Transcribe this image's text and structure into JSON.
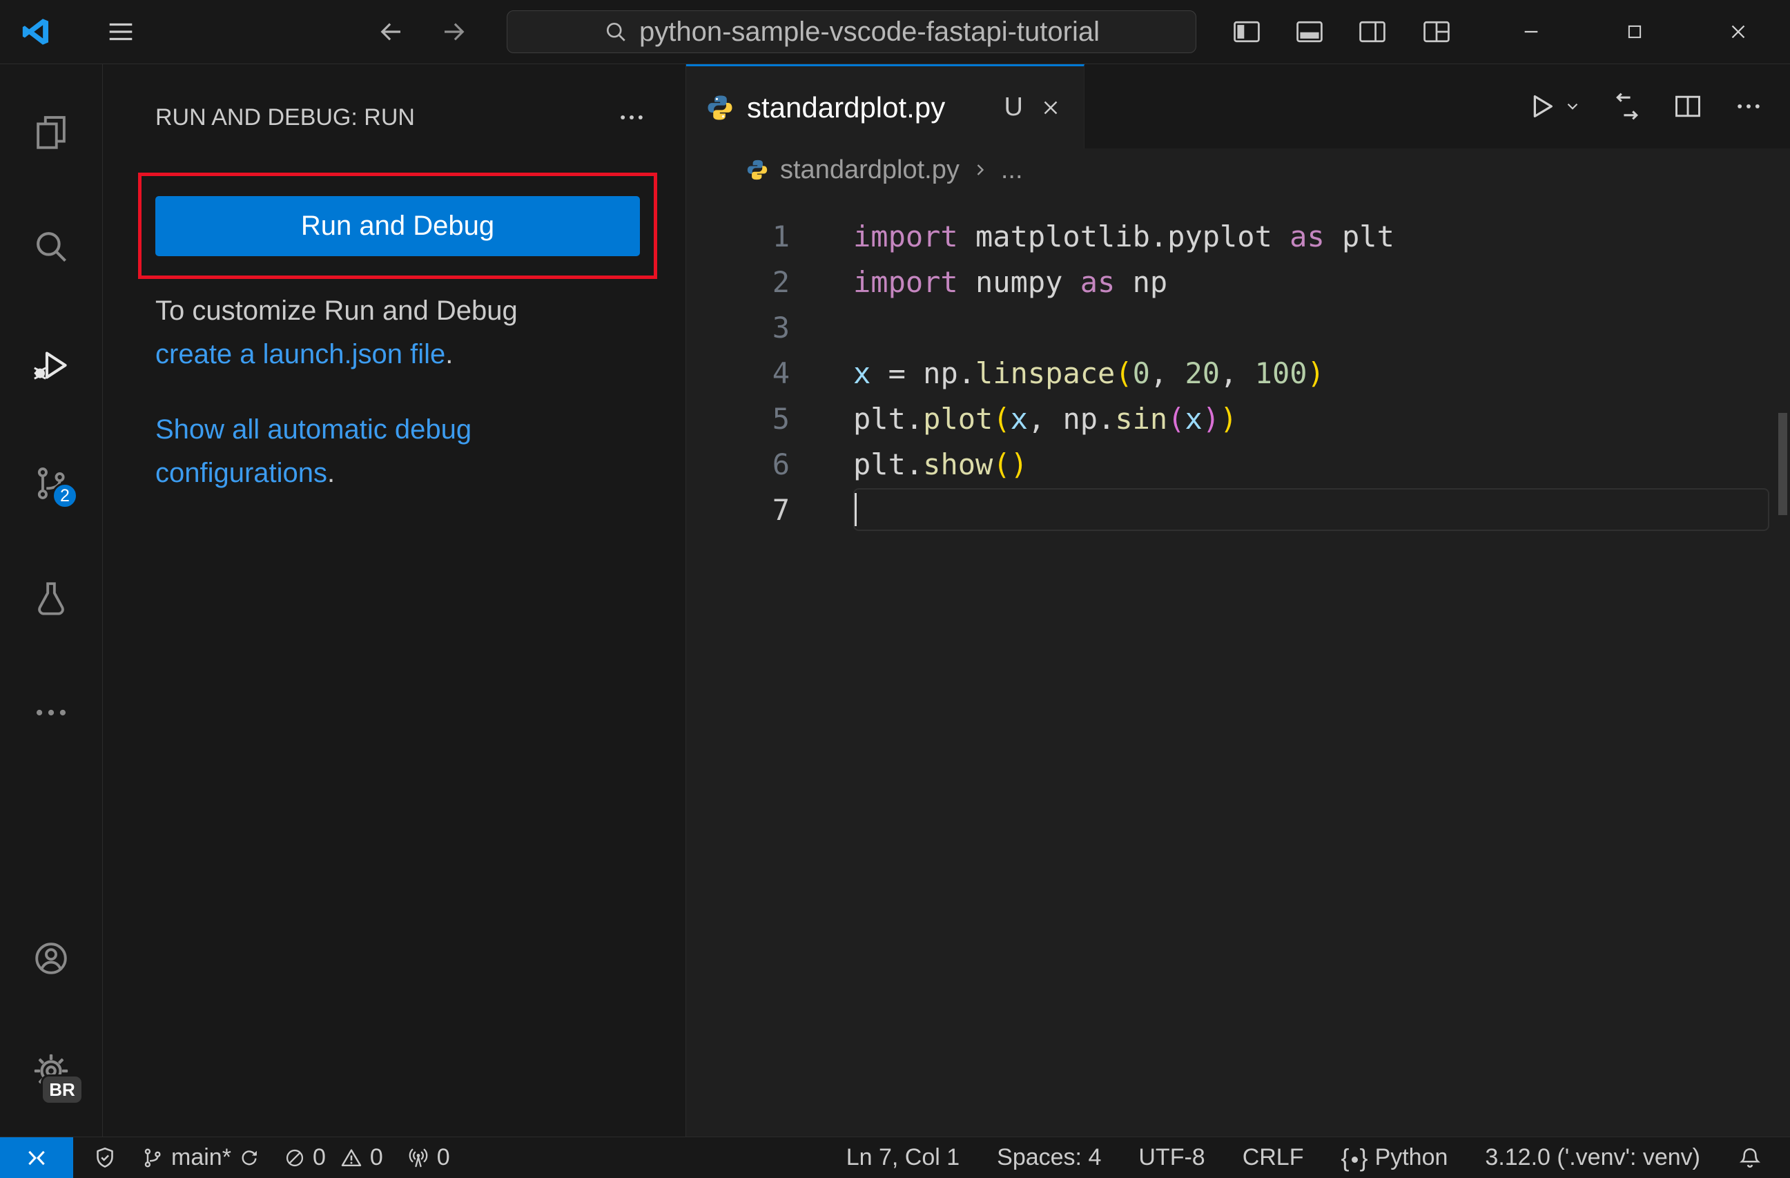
{
  "window": {
    "search_text": "python-sample-vscode-fastapi-tutorial"
  },
  "activity_bar": {
    "scm_badge": "2",
    "profile_badge": "BR"
  },
  "sidebar": {
    "title": "RUN AND DEBUG: RUN",
    "run_button": "Run and Debug",
    "customize_text": "To customize Run and Debug",
    "launch_link": "create a launch.json file",
    "launch_period": ".",
    "auto_link": "Show all automatic debug configurations",
    "auto_period": "."
  },
  "editor": {
    "tab": {
      "label": "standardplot.py",
      "dirty": "U"
    },
    "breadcrumb": {
      "file": "standardplot.py",
      "symbol": "..."
    },
    "code": [
      {
        "n": "1",
        "tokens": [
          [
            "import",
            "kw"
          ],
          [
            " matplotlib.pyplot",
            "id"
          ],
          [
            " as",
            "kw"
          ],
          [
            " plt",
            "id"
          ]
        ]
      },
      {
        "n": "2",
        "tokens": [
          [
            "import",
            "kw"
          ],
          [
            " numpy",
            "id"
          ],
          [
            " as",
            "kw"
          ],
          [
            " np",
            "id"
          ]
        ]
      },
      {
        "n": "3",
        "tokens": []
      },
      {
        "n": "4",
        "tokens": [
          [
            "x",
            "var"
          ],
          [
            " = ",
            "pl"
          ],
          [
            "np",
            "id"
          ],
          [
            ".",
            "pl"
          ],
          [
            "linspace",
            "fn"
          ],
          [
            "(",
            "b1"
          ],
          [
            "0",
            "num"
          ],
          [
            ", ",
            "pl"
          ],
          [
            "20",
            "num"
          ],
          [
            ", ",
            "pl"
          ],
          [
            "100",
            "num"
          ],
          [
            ")",
            "b1"
          ]
        ]
      },
      {
        "n": "5",
        "tokens": [
          [
            "plt",
            "id"
          ],
          [
            ".",
            "pl"
          ],
          [
            "plot",
            "fn"
          ],
          [
            "(",
            "b1"
          ],
          [
            "x",
            "var"
          ],
          [
            ", ",
            "pl"
          ],
          [
            "np",
            "id"
          ],
          [
            ".",
            "pl"
          ],
          [
            "sin",
            "fn"
          ],
          [
            "(",
            "b2"
          ],
          [
            "x",
            "var"
          ],
          [
            ")",
            "b2"
          ],
          [
            ")",
            "b1"
          ]
        ]
      },
      {
        "n": "6",
        "tokens": [
          [
            "plt",
            "id"
          ],
          [
            ".",
            "pl"
          ],
          [
            "show",
            "fn"
          ],
          [
            "(",
            "b1"
          ],
          [
            ")",
            "b1"
          ]
        ]
      },
      {
        "n": "7",
        "tokens": [],
        "current": true
      }
    ]
  },
  "status_bar": {
    "branch": "main*",
    "errors": "0",
    "warnings": "0",
    "ports": "0",
    "cursor": "Ln 7, Col 1",
    "indent": "Spaces: 4",
    "encoding": "UTF-8",
    "eol": "CRLF",
    "language": "Python",
    "interpreter": "3.12.0 ('.venv': venv)"
  },
  "icons": {
    "remote": "open-remote-window",
    "shield": "workspace-trust",
    "branch": "source-control-branch",
    "sync": "synchronize-changes",
    "error": "no-errors-circle-slash",
    "warning": "warning-triangle",
    "radio": "ports-radio-tower",
    "bell": "notifications-bell",
    "python": "python-logo",
    "vscode": "vscode-logo"
  },
  "colors": {
    "accent": "#0078d4",
    "link": "#3c9cf0",
    "annotation": "#e81123",
    "editor_bg": "#1f1f1f",
    "shell_bg": "#181818"
  },
  "token_colors": {
    "kw": "#c586c0",
    "id": "#d4d4d4",
    "var": "#9cdcfe",
    "fn": "#dcdcaa",
    "num": "#b5cea8",
    "pl": "#d4d4d4",
    "b1": "#ffd700",
    "b2": "#da70d6"
  }
}
